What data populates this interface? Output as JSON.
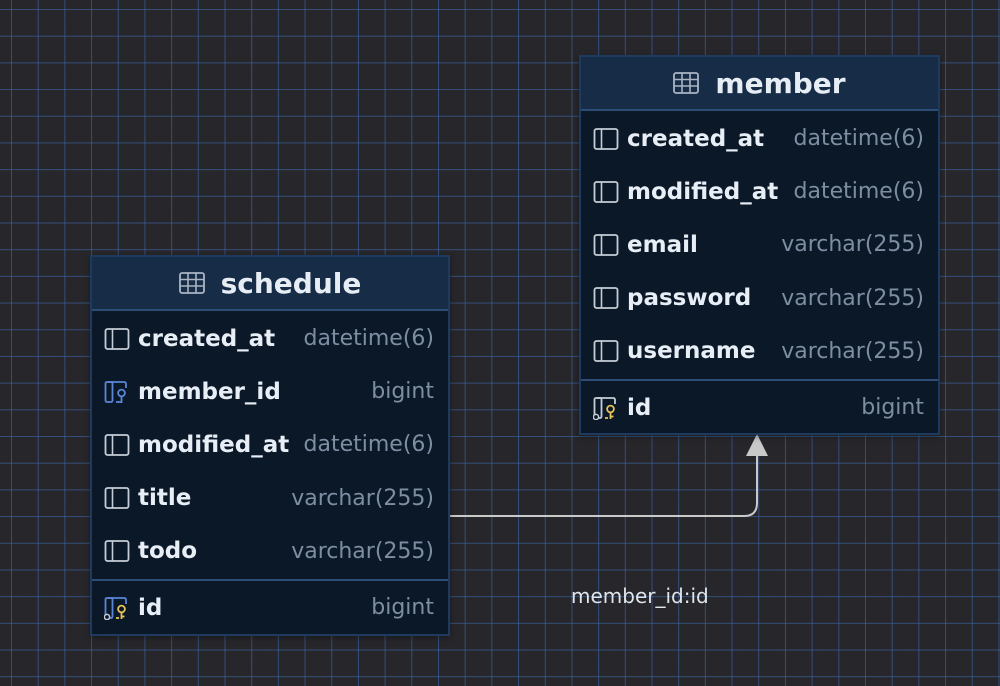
{
  "diagram": {
    "tables": {
      "member": {
        "name": "member",
        "columns": [
          {
            "name": "created_at",
            "type": "datetime(6)"
          },
          {
            "name": "modified_at",
            "type": "datetime(6)"
          },
          {
            "name": "email",
            "type": "varchar(255)"
          },
          {
            "name": "password",
            "type": "varchar(255)"
          },
          {
            "name": "username",
            "type": "varchar(255)"
          }
        ],
        "primary_key": {
          "name": "id",
          "type": "bigint"
        }
      },
      "schedule": {
        "name": "schedule",
        "columns": [
          {
            "name": "created_at",
            "type": "datetime(6)"
          },
          {
            "name": "member_id",
            "type": "bigint"
          },
          {
            "name": "modified_at",
            "type": "datetime(6)"
          },
          {
            "name": "title",
            "type": "varchar(255)"
          },
          {
            "name": "todo",
            "type": "varchar(255)"
          }
        ],
        "primary_key": {
          "name": "id",
          "type": "bigint"
        }
      }
    },
    "relation": {
      "label": "member_id:id",
      "from": "schedule.member_id",
      "to": "member.id"
    },
    "icons": {
      "table": "table-icon",
      "column": "column-icon",
      "foreign_key": "foreign-key-icon",
      "primary_key": "primary-key-icon"
    },
    "colors": {
      "background": "#27272b",
      "grid": "#3f6eb9",
      "table_body": "#0b1828",
      "table_header": "#172c47",
      "border": "#1e3a5e",
      "key_yellow": "#e8c25a",
      "fk_blue": "#5b86d6",
      "text": "#e8eef6",
      "type_text": "#7d8ea3",
      "connector": "#c9c9c9"
    }
  }
}
